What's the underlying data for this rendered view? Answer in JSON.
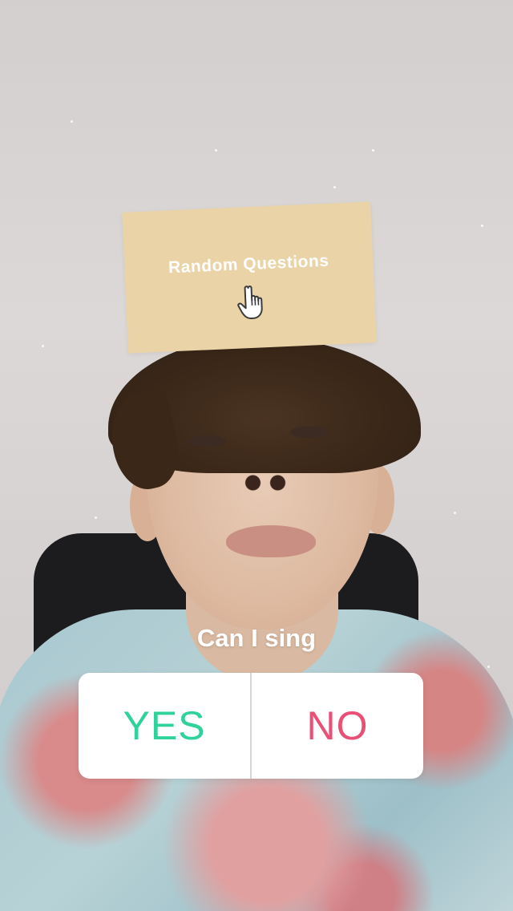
{
  "filter_card": {
    "title": "Random Questions",
    "icon": "pointing-hand-icon",
    "background_color": "#ead4a7"
  },
  "poll": {
    "question": "Can I sing",
    "options": [
      {
        "label": "YES",
        "color": "#2fd39a"
      },
      {
        "label": "NO",
        "color": "#ea4f76"
      }
    ]
  }
}
